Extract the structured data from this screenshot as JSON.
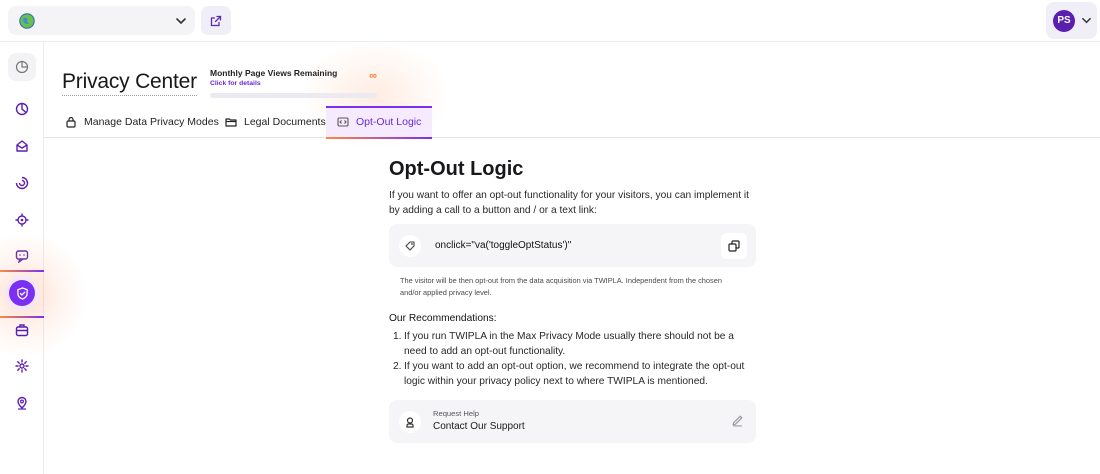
{
  "topbar": {
    "site_select": {
      "value": "",
      "globe_icon": "globe-icon",
      "chevron_icon": "chevron-down-icon"
    },
    "external_link_icon": "external-link-icon",
    "user": {
      "initials": "PS",
      "chevron_icon": "chevron-down-icon"
    }
  },
  "sidebar": {
    "items": [
      {
        "name": "dashboard",
        "icon": "dashboard-icon"
      },
      {
        "name": "analytics",
        "icon": "pie-chart-icon"
      },
      {
        "name": "inbox",
        "icon": "inbox-icon"
      },
      {
        "name": "insights",
        "icon": "spiral-icon"
      },
      {
        "name": "targeting",
        "icon": "target-icon"
      },
      {
        "name": "feedback",
        "icon": "chat-icon"
      },
      {
        "name": "privacy",
        "icon": "shield-icon",
        "active": true
      },
      {
        "name": "toolbox",
        "icon": "briefcase-icon"
      },
      {
        "name": "settings",
        "icon": "gear-icon"
      },
      {
        "name": "location",
        "icon": "location-icon"
      }
    ]
  },
  "header": {
    "title": "Privacy Center",
    "page_views": {
      "label": "Monthly Page Views Remaining",
      "link": "Click for details",
      "value": "∞"
    }
  },
  "tabs": [
    {
      "label": "Manage Data Privacy Modes",
      "icon": "lock-icon"
    },
    {
      "label": "Legal Documents",
      "icon": "folder-icon"
    },
    {
      "label": "Opt-Out Logic",
      "icon": "code-window-icon",
      "active": true
    }
  ],
  "main": {
    "heading": "Opt-Out Logic",
    "intro": "If you want to offer an opt-out functionality for your visitors, you can implement it by adding a call to a button and / or a text link:",
    "code": "onclick=\"va('toggleOptStatus')\"",
    "note": "The visitor will be then opt-out from the data acquisition via TWIPLA. Independent from the chosen and/or applied privacy level.",
    "recommendations_title": "Our Recommendations:",
    "recommendations": [
      "If you run TWIPLA in the Max Privacy Mode usually there should not be a need to add an opt-out functionality.",
      "If you want to add an opt-out option, we recommend to integrate the opt-out logic within your privacy policy next to where TWIPLA is mentioned."
    ],
    "help": {
      "label": "Request Help",
      "value": "Contact Our Support"
    }
  },
  "colors": {
    "accent": "#7b2ff2",
    "accent_orange": "#ff8a3d",
    "active_tab_bg": "#f6eafe"
  }
}
